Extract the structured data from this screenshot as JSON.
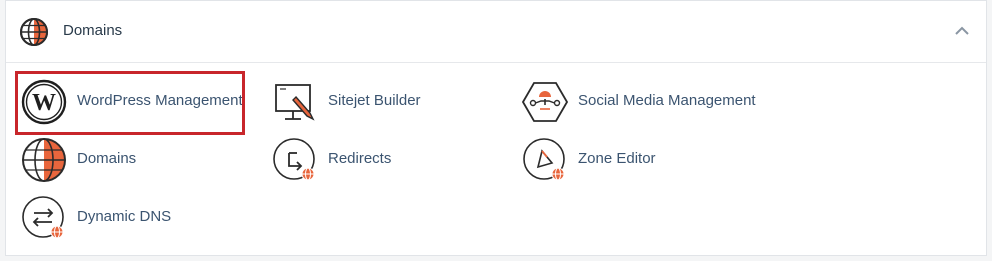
{
  "section": {
    "title": "Domains",
    "header_icon": "globe-icon",
    "collapse_icon": "chevron-up-icon"
  },
  "colors": {
    "accent": "#e8663d",
    "highlight": "#c8262b",
    "label": "#3b5470",
    "icon_stroke": "#2b2b2b"
  },
  "tools": {
    "wordpress": {
      "label": "WordPress Management",
      "icon": "wordpress-icon"
    },
    "sitejet": {
      "label": "Sitejet Builder",
      "icon": "monitor-pencil-icon"
    },
    "social": {
      "label": "Social Media Management",
      "icon": "social-media-hexagon-icon"
    },
    "domains": {
      "label": "Domains",
      "icon": "globe-icon"
    },
    "redirects": {
      "label": "Redirects",
      "icon": "redirect-arrow-icon"
    },
    "zone_editor": {
      "label": "Zone Editor",
      "icon": "zone-editor-icon"
    },
    "dynamic_dns": {
      "label": "Dynamic DNS",
      "icon": "dynamic-dns-icon"
    }
  }
}
